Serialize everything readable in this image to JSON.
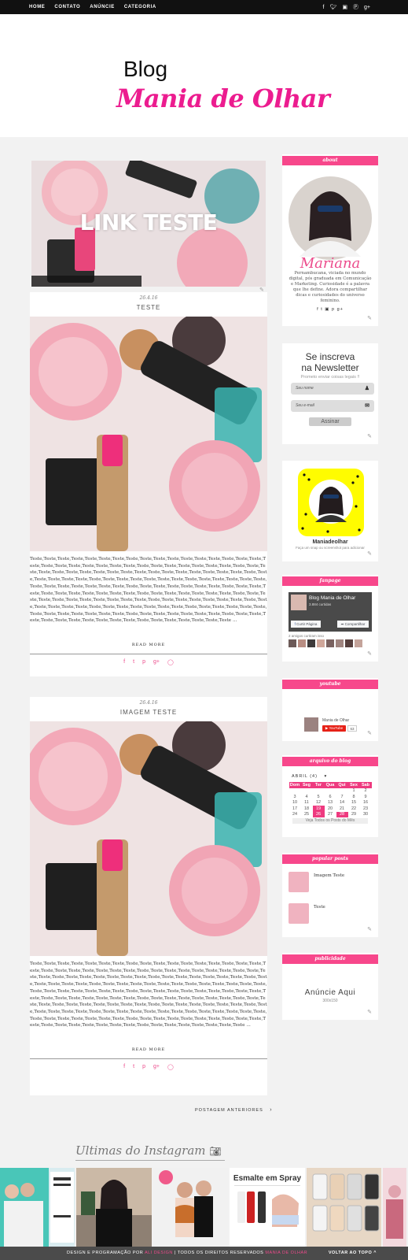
{
  "nav": {
    "items": [
      "HOME",
      "CONTATO",
      "ANÚNCIE",
      "CATEGORIA"
    ],
    "social_icons": [
      "facebook-icon",
      "twitter-icon",
      "instagram-icon",
      "pinterest-icon",
      "google-plus-icon"
    ]
  },
  "header": {
    "logo_line1": "Blog",
    "logo_line2": "Mania de Olhar"
  },
  "featured": {
    "title": "LINK TESTE"
  },
  "posts": [
    {
      "date": "26.4.16",
      "title": "TESTE",
      "excerpt": "Teste,Teste,Teste,Teste,Teste,Teste,Teste,Teste,Teste,Teste,Teste,Teste,Teste,Teste,Teste,Teste,Teste,Teste,Teste,Teste,Teste,Teste,Teste,Teste,Teste,Teste,Teste,Teste,Teste,Teste,Teste,Teste,Teste,Teste,Teste,Teste,Teste,Teste,Teste,Teste,Teste,Teste,Teste,Teste,Teste,Teste,Teste,Teste,Teste,Teste,Teste,Teste,Teste,Teste,Teste,Teste,Teste,Teste,Teste,Teste,Teste,Teste,Teste,Teste,Teste,Teste,Teste,Teste,Teste,Teste,Teste,Teste,Teste,Teste,Teste,Teste,Teste,Teste,Teste,Teste,Teste,Teste,Teste,Teste,Teste,Teste,Teste,Teste,Teste,Teste,Teste,Teste,Teste,Teste,Teste,Teste,Teste,Teste,Teste,Teste,Teste,Teste,Teste,Teste,Teste,Teste,Teste,Teste,Teste,Teste,Teste,Teste,Teste,Teste,Teste,Teste,Teste,Teste,Teste,Teste,Teste,Teste,Teste,Teste,Teste,Teste,Teste,Teste,Teste,Teste,Teste,Teste,Teste,Teste,Teste,Teste,Teste,Teste,Teste,Teste,Teste,Teste,Teste,Teste,Teste,Teste,Teste,Teste,Teste,Teste,Teste,Teste,Teste,Teste,Teste,Teste,Teste,Teste,Teste,Teste,Teste,Teste,Teste,Teste,Teste,Teste,Teste,Teste,Teste,Teste ...",
      "read_more": "READ MORE"
    },
    {
      "date": "26.4.16",
      "title": "IMAGEM TESTE",
      "excerpt": "Teste,Teste,Teste,Teste,Teste,Teste,Teste,Teste,Teste,Teste,Teste,Teste,Teste,Teste,Teste,Teste,Teste,Teste,Teste,Teste,Teste,Teste,Teste,Teste,Teste,Teste,Teste,Teste,Teste,Teste,Teste,Teste,Teste,Teste,Teste,Teste,Teste,Teste,Teste,Teste,Teste,Teste,Teste,Teste,Teste,Teste,Teste,Teste,Teste,Teste,Teste,Teste,Teste,Teste,Teste,Teste,Teste,Teste,Teste,Teste,Teste,Teste,Teste,Teste,Teste,Teste,Teste,Teste,Teste,Teste,Teste,Teste,Teste,Teste,Teste,Teste,Teste,Teste,Teste,Teste,Teste,Teste,Teste,Teste,Teste,Teste,Teste,Teste,Teste,Teste,Teste,Teste,Teste,Teste,Teste,Teste,Teste,Teste,Teste,Teste,Teste,Teste,Teste,Teste,Teste,Teste,Teste,Teste,Teste,Teste,Teste,Teste,Teste,Teste,Teste,Teste,Teste,Teste,Teste,Teste,Teste,Teste,Teste,Teste,Teste,Teste,Teste,Teste,Teste,Teste,Teste,Teste,Teste,Teste,Teste,Teste,Teste,Teste,Teste,Teste,Teste,Teste,Teste,Teste,Teste,Teste,Teste,Teste,Teste,Teste,Teste,Teste,Teste,Teste,Teste,Teste,Teste,Teste,Teste,Teste,Teste,Teste,Teste,Teste,Teste,Teste,Teste,Teste,Teste,Teste,Teste ...",
      "read_more": "READ MORE"
    }
  ],
  "pagination": {
    "older": "POSTAGEM ANTERIORES"
  },
  "sidebar": {
    "about": {
      "heading": "about",
      "signature": "Mariana",
      "text": "Pernambucana, viciada no mundo digital, pós graduada em Comunicação e Marketing. Curiosidade é a palavra que lhe define. Adora compartilhar dicas e curiosidades do universo feminino."
    },
    "newsletter": {
      "title_line1": "Se inscreva",
      "title_line2": "na Newsletter",
      "subtitle": "Prometo enviar coisas legais !!",
      "name_placeholder": "Seu nome",
      "email_placeholder": "Seu e-mail",
      "button": "Assinar"
    },
    "snapchat": {
      "username": "Maniadeolhar",
      "caption": "Faça um snap ou screenshot para adicionar"
    },
    "fanpage": {
      "heading": "fanpage",
      "page_name": "Blog Mania de Olhar",
      "likes": "3.884 curtidas",
      "like_button": "Curtir Página",
      "share_button": "Compartilhar",
      "friends_text": "2 amigos curtiram isso"
    },
    "youtube": {
      "heading": "youtube",
      "channel": "Mania de Olhar",
      "button": "YouTube",
      "count": "63"
    },
    "archive": {
      "heading": "arquivo do blog",
      "month": "ABRIL (4)",
      "days": [
        "Dom",
        "Seg",
        "Ter",
        "Qua",
        "Qui",
        "Sex",
        "Sab"
      ],
      "weeks": [
        [
          "",
          "",
          "",
          "",
          "",
          "1",
          "2"
        ],
        [
          "3",
          "4",
          "5",
          "6",
          "7",
          "8",
          "9"
        ],
        [
          "10",
          "11",
          "12",
          "13",
          "14",
          "15",
          "16"
        ],
        [
          "17",
          "18",
          "19",
          "20",
          "21",
          "22",
          "23"
        ],
        [
          "24",
          "25",
          "26",
          "27",
          "28",
          "29",
          "30"
        ]
      ],
      "footer": "Veja Todos os Posts do Mês"
    },
    "popular": {
      "heading": "popular posts",
      "items": [
        "Imagem Teste",
        "Teste"
      ]
    },
    "ads": {
      "heading": "publicidade",
      "title": "Anúncie Aqui",
      "size": "300x150"
    }
  },
  "instagram": {
    "title": "Ultimas do Instagram",
    "photo3_text": "Esmalte em Spray"
  },
  "footer": {
    "text_prefix": "DESIGN E PROGRAMAÇÃO POR",
    "designer": "ALI DESIGN",
    "text_rights": "| TODOS OS DIREITOS RESERVADOS",
    "blog_link": "MANIA DE OLHAR",
    "back_to_top": "VOLTAR AO TOPO ^"
  }
}
